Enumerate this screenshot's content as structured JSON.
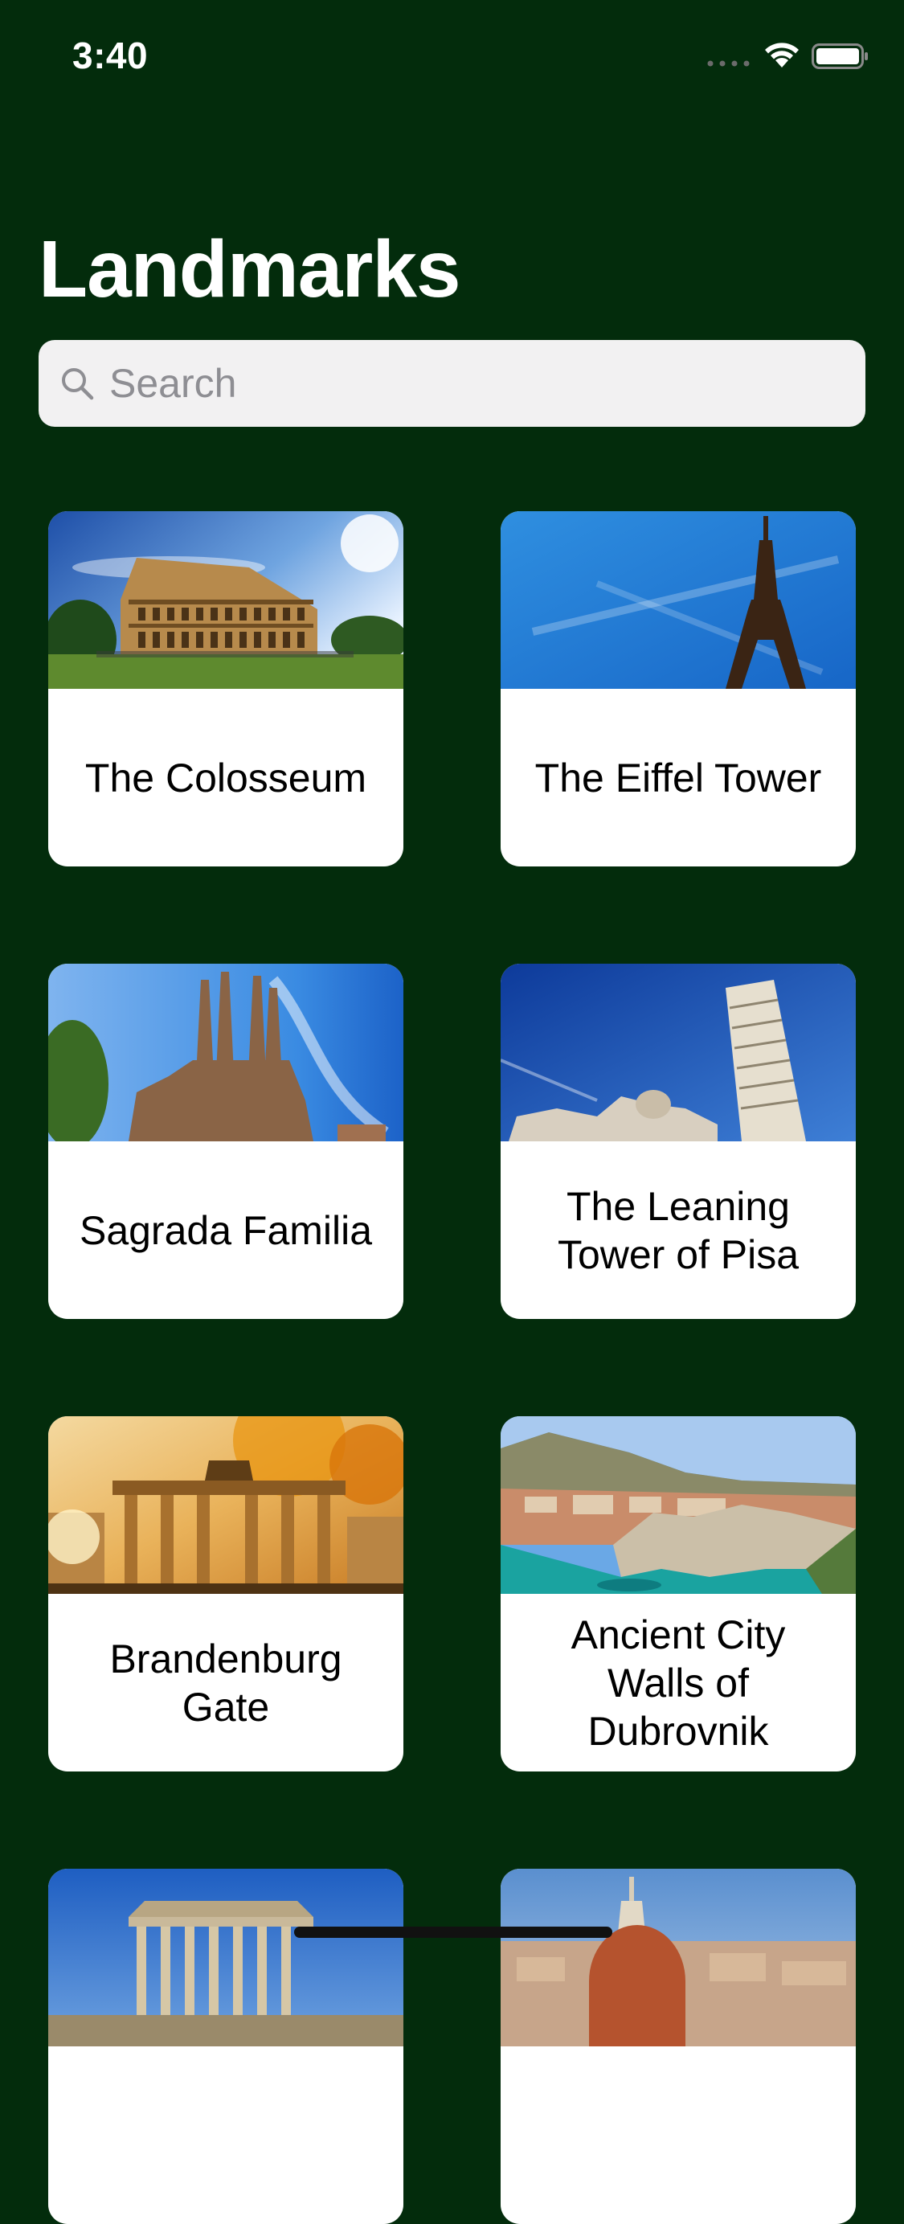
{
  "status_bar": {
    "time": "3:40",
    "icons": [
      "signal-dots-icon",
      "wifi-icon",
      "battery-icon"
    ]
  },
  "title": "Landmarks",
  "search": {
    "placeholder": "Search",
    "value": ""
  },
  "landmarks": [
    {
      "name": "The Colosseum",
      "image": "colosseum-photo"
    },
    {
      "name": "The Eiffel Tower",
      "image": "eiffel-tower-photo"
    },
    {
      "name": "Sagrada Familia",
      "image": "sagrada-familia-photo"
    },
    {
      "name": "The Leaning Tower of Pisa",
      "image": "leaning-tower-photo"
    },
    {
      "name": "Brandenburg Gate",
      "image": "brandenburg-gate-photo"
    },
    {
      "name": "Ancient City Walls of Dubrovnik",
      "image": "dubrovnik-walls-photo"
    },
    {
      "name": "",
      "image": "acropolis-photo"
    },
    {
      "name": "",
      "image": "florence-cathedral-photo"
    }
  ],
  "colors": {
    "background": "#032c0c",
    "search_field": "#f2f1f2",
    "card": "#ffffff",
    "title": "#ffffff"
  }
}
